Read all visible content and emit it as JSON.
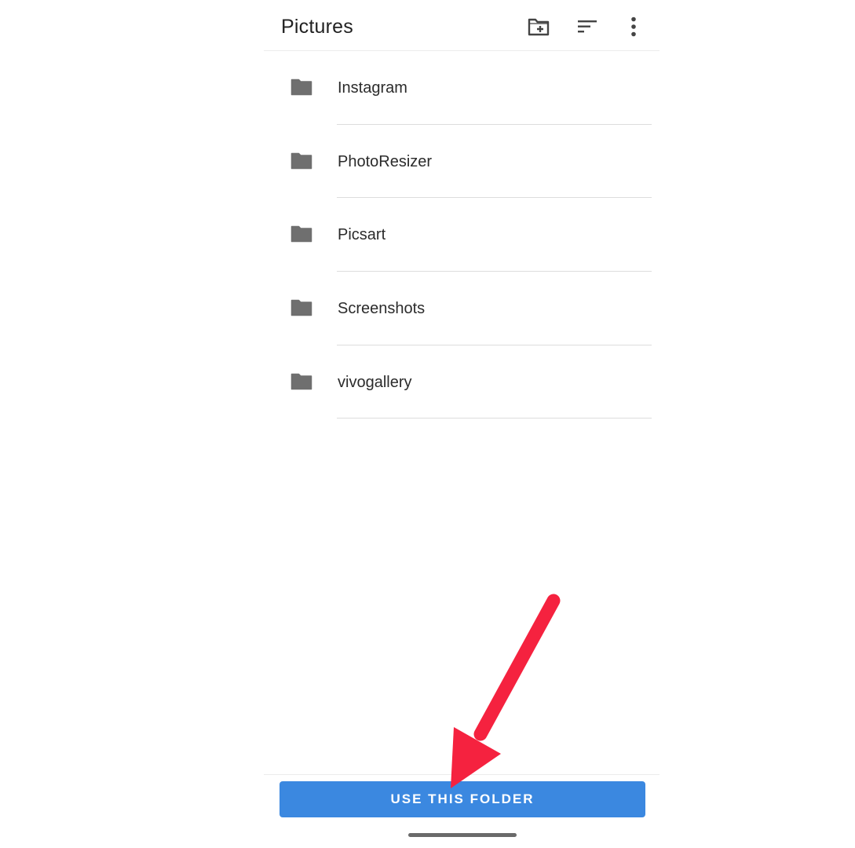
{
  "app_bar": {
    "title": "Pictures",
    "actions": [
      {
        "icon": "create-new-folder-icon"
      },
      {
        "icon": "sort-icon"
      },
      {
        "icon": "more-vert-icon"
      }
    ]
  },
  "folders": [
    {
      "name": "Instagram",
      "icon": "folder-icon"
    },
    {
      "name": "PhotoResizer",
      "icon": "folder-icon"
    },
    {
      "name": "Picsart",
      "icon": "folder-icon"
    },
    {
      "name": "Screenshots",
      "icon": "folder-icon"
    },
    {
      "name": "vivogallery",
      "icon": "folder-icon"
    }
  ],
  "primary_action": {
    "label": "USE THIS FOLDER",
    "color": "#3b88e0"
  },
  "annotation": {
    "type": "arrow",
    "color": "#f5223f",
    "points_to": "use-this-folder-button"
  },
  "colors": {
    "icon": "#6f6f6f",
    "text": "#2b2b2b",
    "divider": "#dddddd"
  }
}
